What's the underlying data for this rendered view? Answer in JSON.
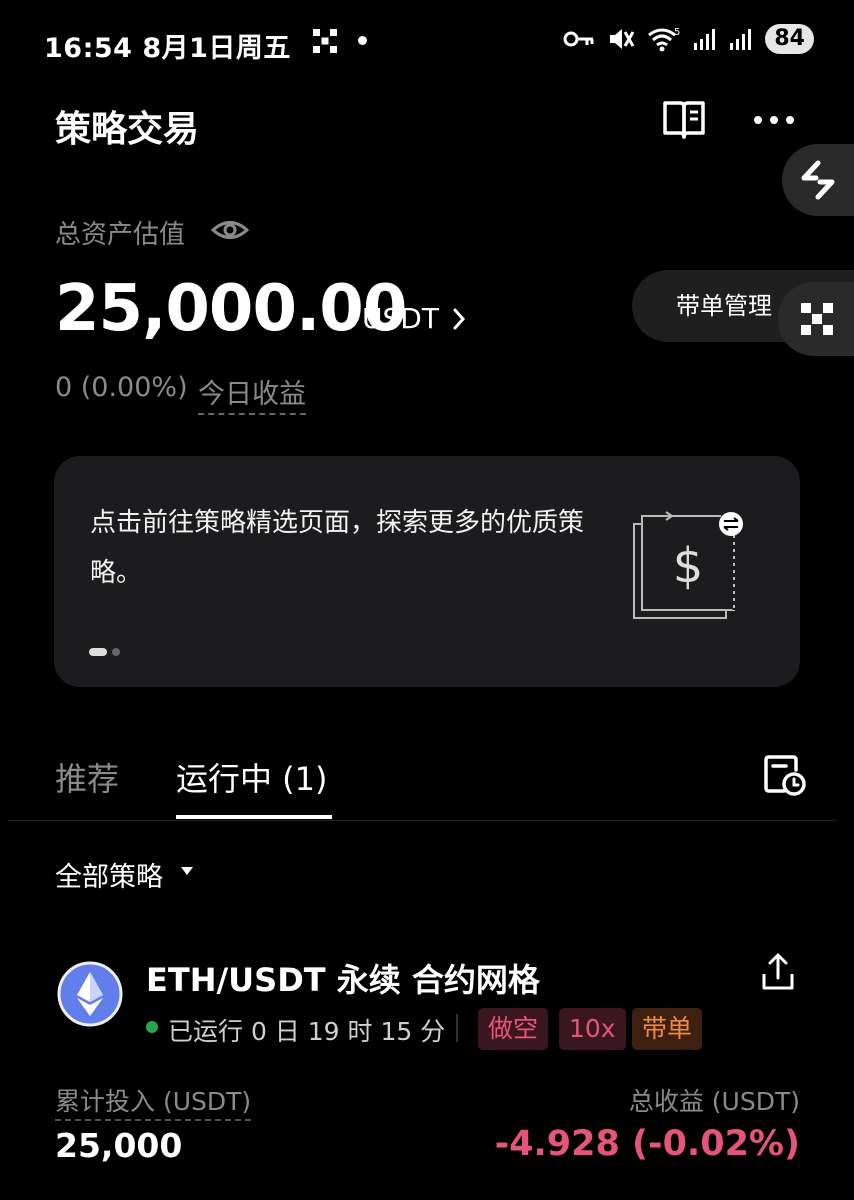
{
  "status_bar": {
    "time": "16:54 8月1日周五",
    "battery": "84"
  },
  "header": {
    "title": "策略交易"
  },
  "floating": {
    "copy_manage_label": "带单管理"
  },
  "assets": {
    "label": "总资产估值",
    "value": "25,000.00",
    "unit": "USDT",
    "today_pnl_value": "0 (0.00%)",
    "today_pnl_label": "今日收益"
  },
  "banner": {
    "text": "点击前往策略精选页面，探索更多的优质策略。",
    "slide_index": 1,
    "slide_count": 2
  },
  "tabs": {
    "recommend": "推荐",
    "running": "运行中 (1)"
  },
  "filter": {
    "label": "全部策略"
  },
  "strategy": {
    "title": "ETH/USDT 永续 合约网格",
    "runtime": "已运行 0 日 19 时 15 分",
    "tags": [
      "做空",
      "10x",
      "带单"
    ],
    "invest_label": "累计投入 (USDT)",
    "invest_value": "25,000",
    "profit_label": "总收益 (USDT)",
    "profit_value": "-4.928 (-0.02%)"
  },
  "colors": {
    "background": "#000000",
    "loss_red": "#e65579",
    "running_green": "#25a750",
    "copy_orange": "#ee8a44",
    "eth_blue": "#627eea"
  },
  "icons": [
    "okx-logo-icon",
    "dot-icon",
    "key-icon",
    "mute-icon",
    "wifi-icon",
    "signal-icon",
    "guide-book-icon",
    "more-icon",
    "switch-icon",
    "eye-icon",
    "chevron-right-icon",
    "history-icon",
    "caret-down-icon",
    "eth-icon",
    "share-icon"
  ]
}
